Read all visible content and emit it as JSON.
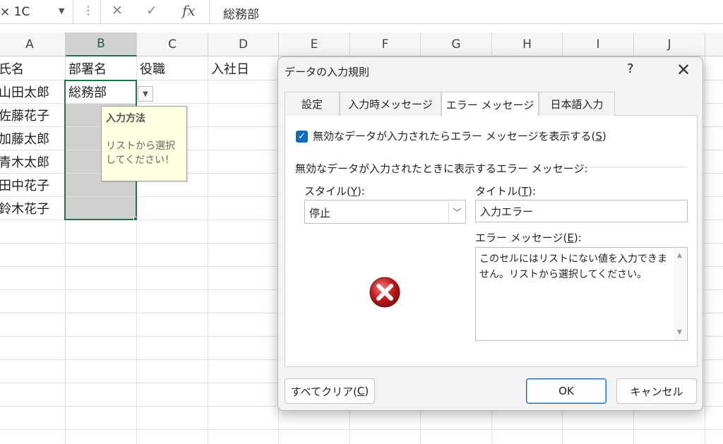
{
  "formula_bar": {
    "name_box": "× 1C",
    "content": "総務部"
  },
  "columns": [
    "A",
    "B",
    "C",
    "D",
    "E",
    "F",
    "G",
    "H",
    "I",
    "J"
  ],
  "rows": [
    [
      "氏名",
      "部署名",
      "役職",
      "入社日"
    ],
    [
      "山田太郎",
      "総務部",
      "",
      ""
    ],
    [
      "佐藤花子",
      "",
      "",
      ""
    ],
    [
      "加藤太郎",
      "",
      "",
      ""
    ],
    [
      "青木太郎",
      "",
      "",
      ""
    ],
    [
      "田中花子",
      "",
      "",
      ""
    ],
    [
      "鈴木花子",
      "",
      "",
      ""
    ]
  ],
  "input_message": {
    "title": "入力方法",
    "line1": "リストから選択",
    "line2": "してください！"
  },
  "dialog": {
    "title": "データの入力規則",
    "help": "?",
    "close": "✕",
    "tabs": [
      "設定",
      "入力時メッセージ",
      "エラー メッセージ",
      "日本語入力"
    ],
    "checkbox_label": "無効なデータが入力されたらエラー メッセージを表示する(",
    "checkbox_key": "S",
    "section_label": "無効なデータが入力されたときに表示するエラー メッセージ:",
    "style_label": "スタイル(",
    "style_key": "Y",
    "style_value": "停止",
    "title_label": "タイトル(",
    "title_key": "T",
    "title_value": "入力エラー",
    "message_label": "エラー メッセージ(",
    "message_key": "E",
    "message_line1": "このセルにはリストにない値を入力できま",
    "message_line2": "せん。リストから選択してください。",
    "clear_label": "すべてクリア(",
    "clear_key": "C",
    "ok_label": "OK",
    "cancel_label": "キャンセル"
  }
}
